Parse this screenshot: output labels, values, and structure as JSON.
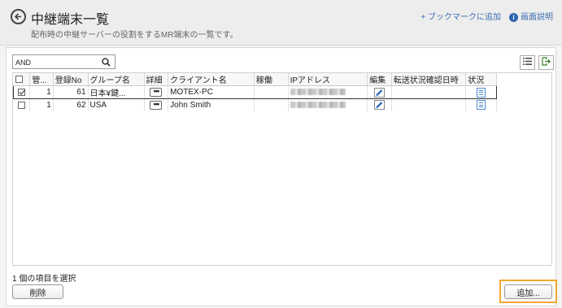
{
  "header": {
    "title": "中継端末一覧",
    "subtitle": "配布時の中継サーバーの役割をするMR端末の一覧です。",
    "bookmark_link": "+ ブックマークに追加",
    "help_link": "画面説明"
  },
  "toolbar": {
    "search_value": "AND",
    "search_placeholder": ""
  },
  "table": {
    "columns": [
      "管...",
      "登録No",
      "グループ名",
      "詳細",
      "クライアント名",
      "稼働",
      "IPアドレス",
      "編集",
      "転送状況確認日時",
      "状況"
    ],
    "rows": [
      {
        "checked": true,
        "kan": "1",
        "reg_no": "61",
        "group": "日本¥鍵...",
        "client": "MOTEX-PC",
        "kadou": "",
        "ip": "",
        "transfer_time": ""
      },
      {
        "checked": false,
        "kan": "1",
        "reg_no": "62",
        "group": "USA",
        "client": "John Smith",
        "kadou": "",
        "ip": "",
        "transfer_time": ""
      }
    ]
  },
  "footer": {
    "selection_status": "1 個の項目を選択",
    "delete_label": "削除",
    "add_label": "追加..."
  },
  "colors": {
    "accent": "#3a6fb0",
    "highlight": "#f0a830",
    "edit_icon": "#1f5fb3"
  }
}
